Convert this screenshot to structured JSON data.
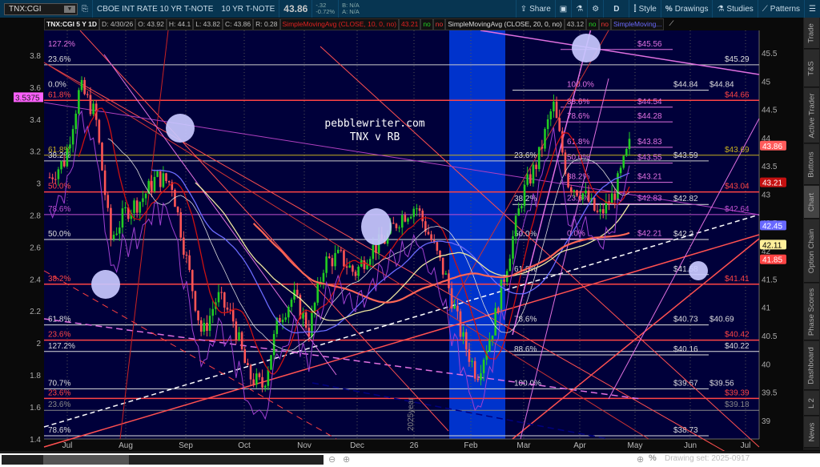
{
  "toolbar": {
    "symbol": "TNX:CGI",
    "description": "CBOE INT RATE 10 YR T-NOTE",
    "short_name": "10 YR T-NOTE",
    "last": "43.86",
    "change": "-.32",
    "change_pct": "-0.72%",
    "bid": "B: N/A",
    "ask": "A: N/A",
    "share": "Share",
    "period": "D",
    "style": "Style",
    "drawings": "Drawings",
    "studies": "Studies",
    "patterns": "Patterns"
  },
  "info": {
    "title": "TNX:CGI 5 Y 1D",
    "date": "D: 4/30/26",
    "open": "O: 43.92",
    "high": "H: 44.1",
    "low": "L: 43.82",
    "close": "C: 43.86",
    "range": "R: 0.28",
    "sma10": "SimpleMovingAvg (CLOSE, 10, 0, no)",
    "sma10_val": "43.21",
    "sma20": "SimpleMovingAvg (CLOSE, 20, 0, no)",
    "sma20_val": "43.12",
    "no": "no",
    "sma3": "SimpleMoving..."
  },
  "tabs": [
    "Trade",
    "T&S",
    "Active Trader",
    "Buttons",
    "Chart",
    "Option Chain",
    "Phase Scores",
    "Dashboard",
    "L 2",
    "News"
  ],
  "drawing_set": "Drawing set: 2025-0917",
  "colors": {
    "bg": "#00003a",
    "red": "#ff5555",
    "magenta": "#e070e0",
    "yellow": "#d8c020",
    "band": "#0033cc"
  },
  "chart_data": {
    "type": "candlestick",
    "watermark": [
      "pebblewriter.com",
      "TNX v RB"
    ],
    "year_label": "2025year",
    "x_ticks": [
      "Jul",
      "Aug",
      "Sep",
      "Oct",
      "Nov",
      "Dec",
      "26",
      "Feb",
      "Mar",
      "Apr",
      "May",
      "Jun",
      "Jul"
    ],
    "right_ticks": [
      "45.5",
      "45",
      "44.5",
      "44",
      "43.5",
      "43",
      "42.5",
      "42",
      "41.5",
      "41",
      "40.5",
      "40",
      "39.5",
      "39"
    ],
    "left_ticks": [
      "3.8",
      "3.6",
      "3.4",
      "3.2",
      "3",
      "2.8",
      "2.6",
      "2.4",
      "2.2",
      "2",
      "1.8",
      "1.6",
      "1.4"
    ],
    "price_path": [
      43.3,
      43.6,
      44.9,
      44.4,
      42.2,
      42.7,
      42.9,
      43.3,
      43.2,
      41.8,
      40.5,
      41.2,
      40.8,
      39.8,
      39.6,
      40.8,
      41.2,
      40.6,
      41.8,
      41.9,
      41.6,
      42.0,
      42.2,
      42.6,
      42.8,
      42.2,
      41.5,
      40.5,
      39.8,
      40.6,
      41.8,
      43.0,
      43.6,
      44.6,
      43.2,
      43.0,
      42.6,
      43.0,
      43.86
    ],
    "price_tags": [
      {
        "v": "43.86",
        "bg": "#ff5b5b",
        "fg": "#fff"
      },
      {
        "v": "43.21",
        "bg": "#c41010",
        "fg": "#fff"
      },
      {
        "v": "42.45",
        "bg": "#6868ff",
        "fg": "#fff"
      },
      {
        "v": "42.11",
        "bg": "#ffef9a",
        "fg": "#000"
      },
      {
        "v": "41.85",
        "bg": "#ff4444",
        "fg": "#fff"
      }
    ],
    "left_tag": "3.5375",
    "levels": [
      {
        "v": 45.56,
        "c": "#e070e0",
        "l": "127.2%",
        "r": "$45.56"
      },
      {
        "v": 45.29,
        "c": "#cccccc",
        "l": "23.6%",
        "r": "$45.29"
      },
      {
        "v": 44.84,
        "c": "#e0e0e0",
        "l": "0.0%",
        "m": "100.0%",
        "r": "$44.84",
        "r2": "$44.84"
      },
      {
        "v": 44.66,
        "c": "#ff4444",
        "l": "61.8%",
        "r": "$44.66"
      },
      {
        "v": 44.54,
        "c": "#e070e0",
        "m": "88.6%",
        "r": "$44.54"
      },
      {
        "v": 44.28,
        "c": "#e070e0",
        "m": "78.6%",
        "r": "$44.28"
      },
      {
        "v": 43.83,
        "c": "#e070e0",
        "m": "61.8%",
        "r": "$43.83"
      },
      {
        "v": 43.69,
        "c": "#c8b020",
        "l": "61.8%",
        "r": "$43.69"
      },
      {
        "v": 43.59,
        "c": "#cccccc",
        "l": "38.2%",
        "l2": "23.6%",
        "r": "$43.59"
      },
      {
        "v": 43.55,
        "c": "#e070e0",
        "m": "50.0%",
        "r": "$43.55"
      },
      {
        "v": 43.21,
        "c": "#e070e0",
        "m": "38.2%",
        "r": "$43.21"
      },
      {
        "v": 43.04,
        "c": "#ff4444",
        "l": "50.0%",
        "r": "$43.04"
      },
      {
        "v": 42.83,
        "c": "#e070e0",
        "m": "23.6%",
        "r": "$42.83"
      },
      {
        "v": 42.82,
        "c": "#e0e0e0",
        "l2": "38.2%",
        "r": "$42.82"
      },
      {
        "v": 42.64,
        "c": "#c050d0",
        "l": "78.6%",
        "r": "$42.64"
      },
      {
        "v": 42.21,
        "c": "#e070e0",
        "m": "0.0%",
        "r": "$42.21"
      },
      {
        "v": 42.2,
        "c": "#e0e0e0",
        "l": "50.0%",
        "l2": "50.0%",
        "r": "$42.2"
      },
      {
        "v": 41.58,
        "c": "#e0e0e0",
        "l2": "61.8%",
        "r": "$41.58"
      },
      {
        "v": 41.41,
        "c": "#ff4444",
        "l": "38.2%",
        "r": "$41.41"
      },
      {
        "v": 40.69,
        "c": "#e0e0e0",
        "l": "61.8%",
        "l2": "78.6%",
        "r": "$40.73",
        "r2": "$40.69"
      },
      {
        "v": 40.42,
        "c": "#ff4444",
        "l": "23.6%",
        "r": "$40.42"
      },
      {
        "v": 40.22,
        "c": "#dddddd",
        "l": "127.2%",
        "r": "$40.22"
      },
      {
        "v": 40.16,
        "c": "#e0e0e0",
        "l2": "88.6%",
        "r": "$40.16"
      },
      {
        "v": 39.56,
        "c": "#dddddd",
        "l": "70.7%",
        "l2": "100.0%",
        "r": "$39.67",
        "r2": "$39.56"
      },
      {
        "v": 39.39,
        "c": "#ff4444",
        "l": "23.6%",
        "r": "$39.39"
      },
      {
        "v": 39.18,
        "c": "#888888",
        "l": "23.6%",
        "r": "$39.18"
      },
      {
        "v": 38.73,
        "c": "#dddddd",
        "l": "78.6%",
        "r": "$38.73"
      }
    ]
  }
}
